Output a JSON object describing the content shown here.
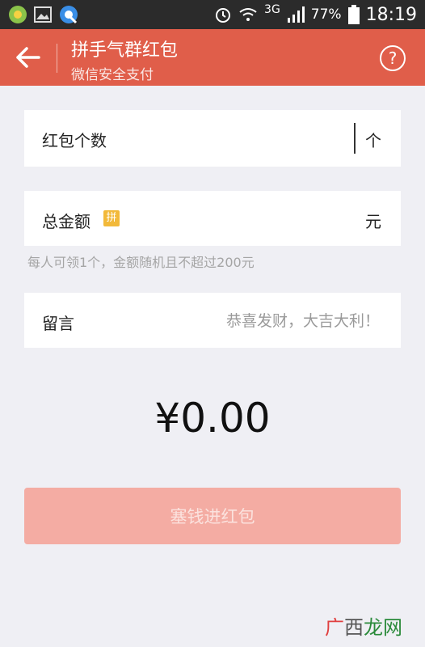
{
  "status_bar": {
    "network": "3G",
    "battery": "77%",
    "time": "18:19"
  },
  "header": {
    "title": "拼手气群红包",
    "subtitle": "微信安全支付",
    "help": "?"
  },
  "form": {
    "count": {
      "label": "红包个数",
      "unit": "个",
      "value": ""
    },
    "total": {
      "label": "总金额",
      "badge": "拼",
      "unit": "元",
      "value": ""
    },
    "hint": "每人可领1个，金额随机且不超过200元",
    "message": {
      "label": "留言",
      "placeholder": "恭喜发财，大吉大利！"
    }
  },
  "amount_display": "¥0.00",
  "submit_label": "塞钱进红包",
  "watermark": {
    "part1": "广",
    "part2": "西",
    "part3": "龙网"
  },
  "colors": {
    "header_bg": "#e05e4a",
    "button_bg": "#f4aca3",
    "badge_bg": "#f2b93a",
    "page_bg": "#efeff4"
  }
}
